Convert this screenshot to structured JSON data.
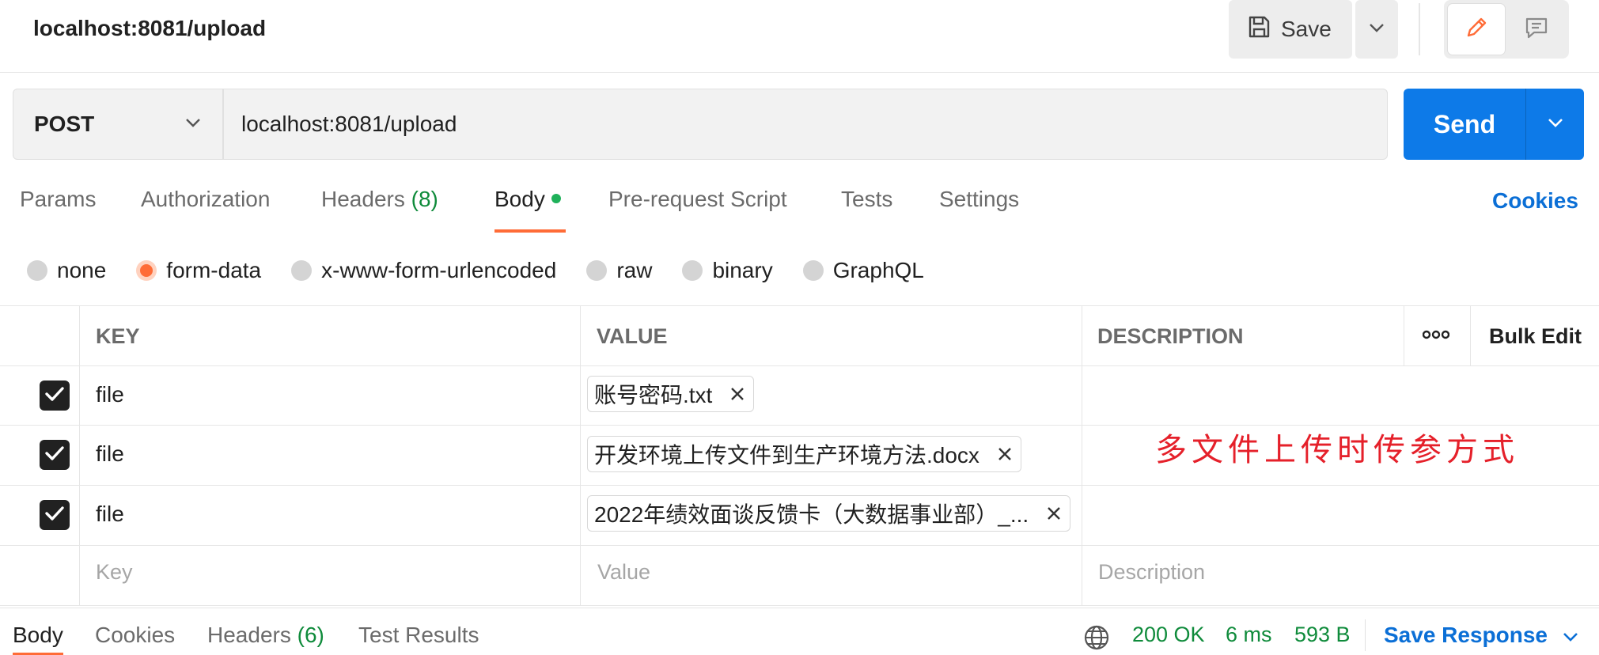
{
  "header": {
    "title": "localhost:8081/upload",
    "save_label": "Save"
  },
  "request": {
    "method": "POST",
    "url": "localhost:8081/upload",
    "send_label": "Send"
  },
  "tabs": {
    "params": "Params",
    "authorization": "Authorization",
    "headers": "Headers",
    "headers_count": "(8)",
    "body": "Body",
    "prerequest": "Pre-request Script",
    "tests": "Tests",
    "settings": "Settings",
    "cookies": "Cookies"
  },
  "body_types": [
    "none",
    "form-data",
    "x-www-form-urlencoded",
    "raw",
    "binary",
    "GraphQL"
  ],
  "body_type_selected": "form-data",
  "table": {
    "headers": {
      "key": "KEY",
      "value": "VALUE",
      "description": "DESCRIPTION",
      "more": "ooo",
      "bulk_edit": "Bulk Edit"
    },
    "rows": [
      {
        "checked": true,
        "key": "file",
        "file": "账号密码.txt"
      },
      {
        "checked": true,
        "key": "file",
        "file": "开发环境上传文件到生产环境方法.docx"
      },
      {
        "checked": true,
        "key": "file",
        "file": "2022年绩效面谈反馈卡（大数据事业部）_..."
      }
    ],
    "placeholders": {
      "key": "Key",
      "value": "Value",
      "description": "Description"
    }
  },
  "annotation": "多文件上传时传参方式",
  "response": {
    "tabs": {
      "body": "Body",
      "cookies": "Cookies",
      "headers": "Headers",
      "headers_count": "(6)",
      "test_results": "Test Results"
    },
    "status": "200 OK",
    "time": "6 ms",
    "size": "593 B",
    "save_response": "Save Response"
  },
  "colors": {
    "accent": "#ff6c37",
    "primary": "#0d7ae8",
    "success": "#0f8b3b",
    "annotation": "#e5202a"
  }
}
